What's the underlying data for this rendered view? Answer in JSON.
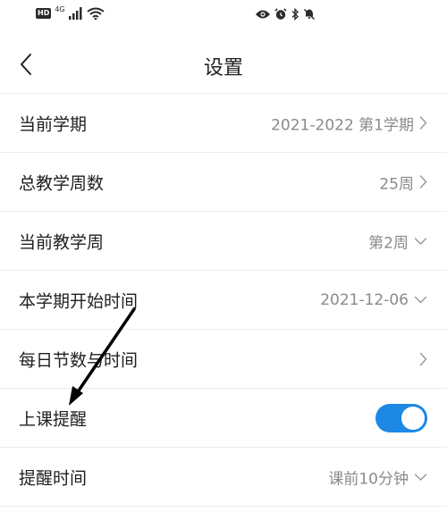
{
  "status_bar": {
    "hd_label": "HD",
    "network_label": "4G"
  },
  "header": {
    "title": "设置"
  },
  "settings": [
    {
      "label": "当前学期",
      "value": "2021-2022 第1学期",
      "control": "chevron-right"
    },
    {
      "label": "总教学周数",
      "value": "25周",
      "control": "chevron-right"
    },
    {
      "label": "当前教学周",
      "value": "第2周",
      "control": "chevron-down"
    },
    {
      "label": "本学期开始时间",
      "value": "2021-12-06",
      "control": "chevron-down"
    },
    {
      "label": "每日节数与时间",
      "value": "",
      "control": "chevron-right"
    },
    {
      "label": "上课提醒",
      "control": "toggle",
      "enabled": true
    },
    {
      "label": "提醒时间",
      "value": "课前10分钟",
      "control": "chevron-down"
    }
  ],
  "colors": {
    "accent": "#1e88e5",
    "value_text": "#8a8a8a",
    "annotation_arrow": "#000000"
  }
}
